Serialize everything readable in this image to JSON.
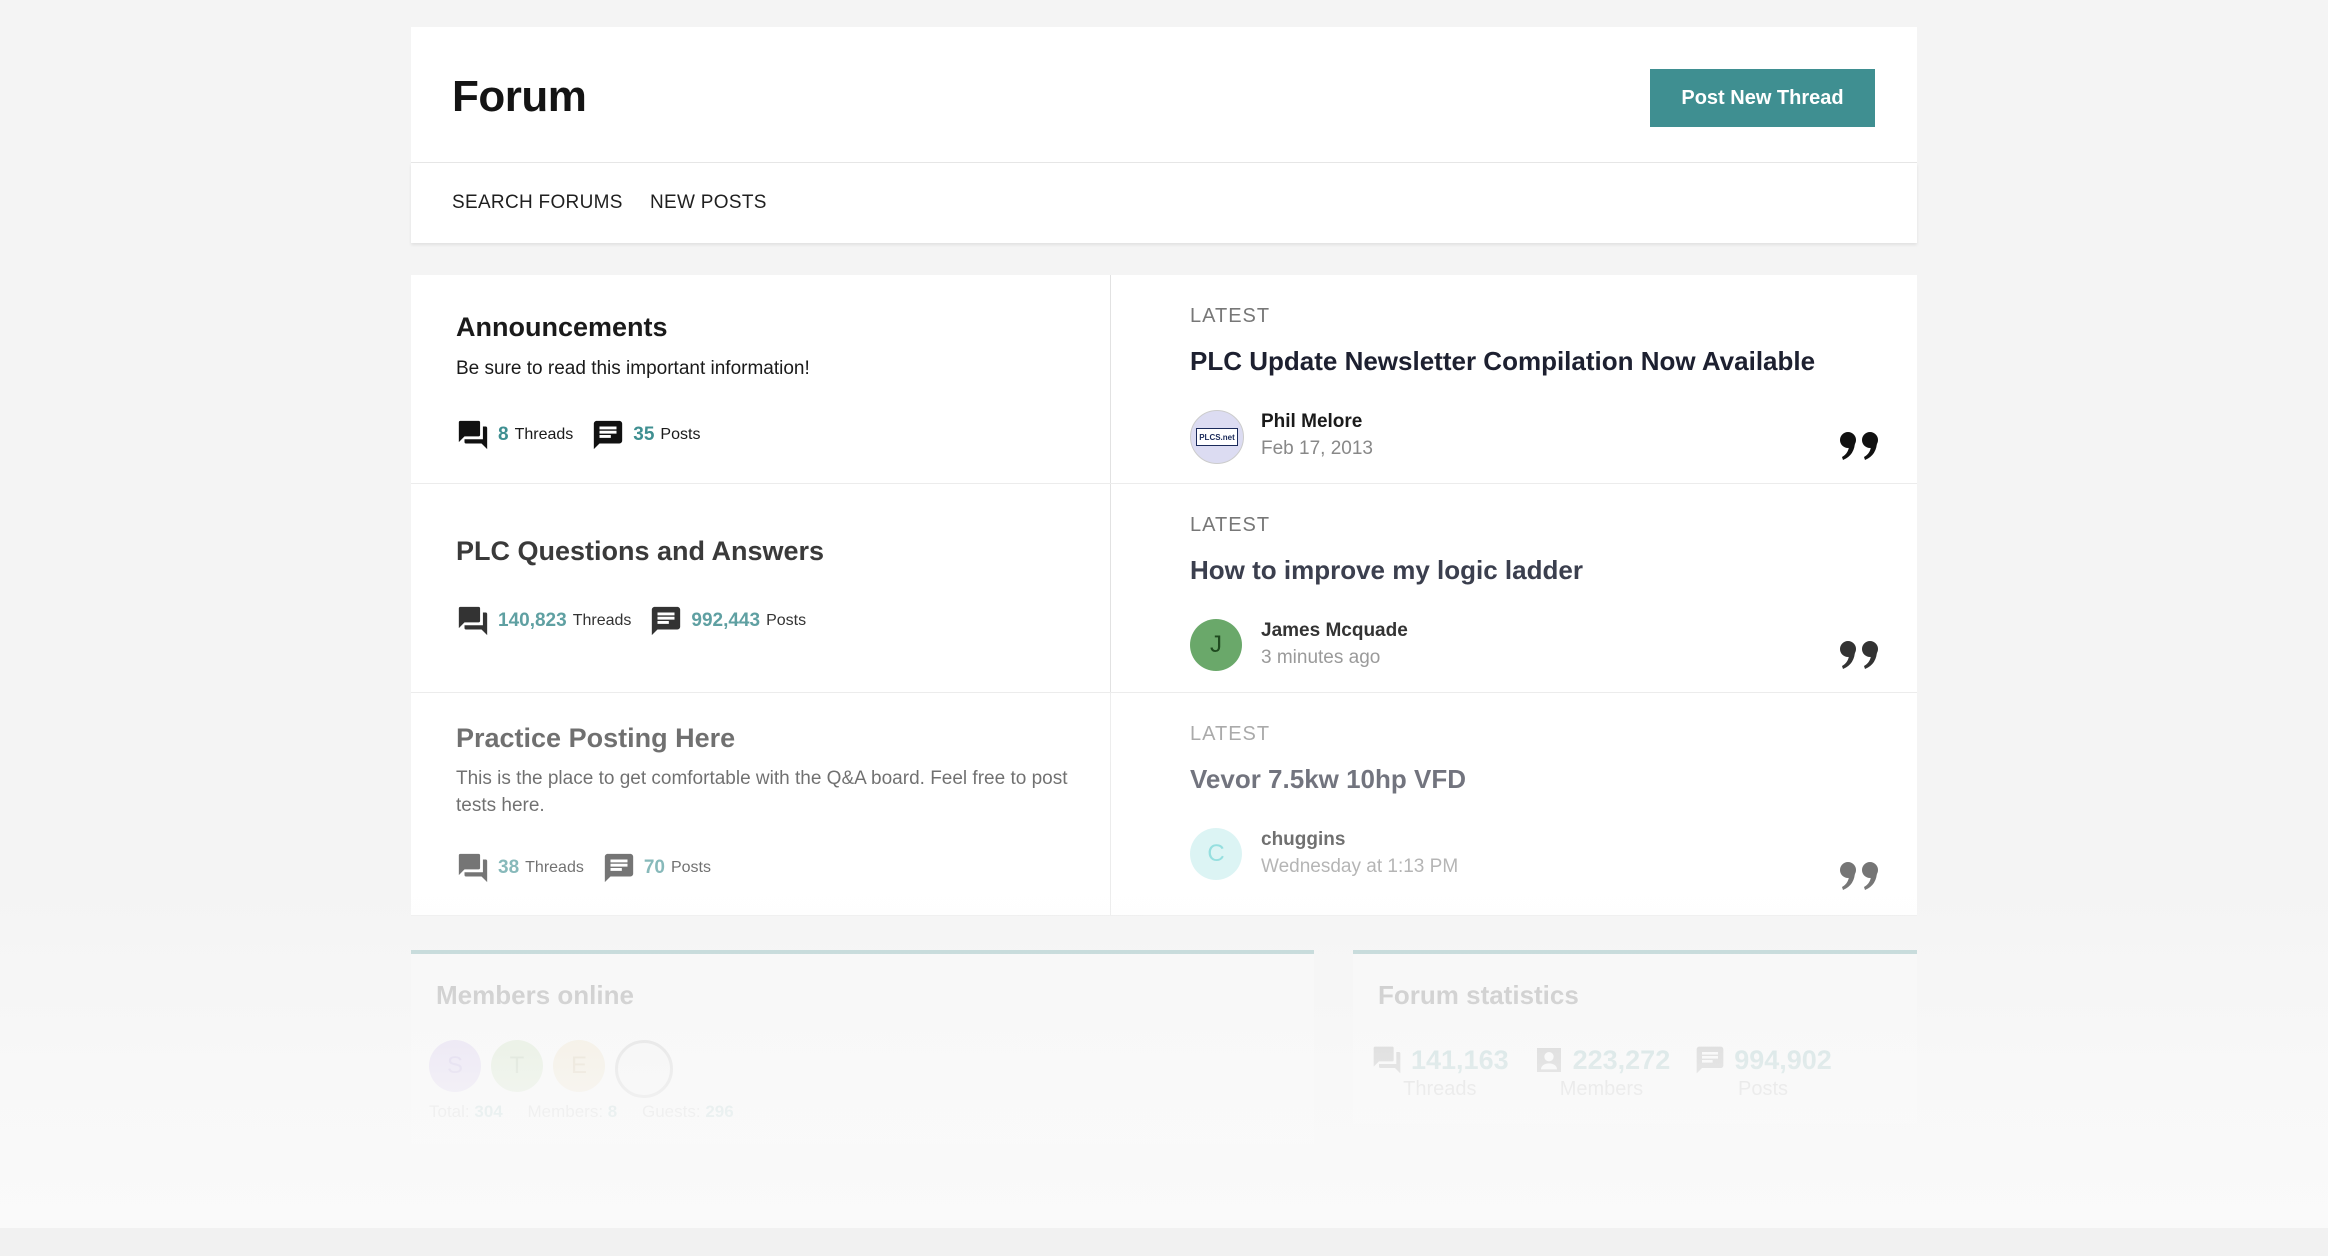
{
  "header": {
    "title": "Forum",
    "post_button": "Post New Thread"
  },
  "nav": {
    "items": [
      "SEARCH FORUMS",
      "NEW POSTS"
    ]
  },
  "forums": [
    {
      "title": "Announcements",
      "description": "Be sure to read this important information!",
      "threads": "8",
      "threads_label": "Threads",
      "posts": "35",
      "posts_label": "Posts",
      "latest_label": "LATEST",
      "latest_title": "PLC Update Newsletter Compilation Now Available",
      "latest_user": "Phil Melore",
      "latest_date": "Feb 17, 2013",
      "avatar_text": "PLCS.net"
    },
    {
      "title": "PLC Questions and Answers",
      "description": "",
      "threads": "140,823",
      "threads_label": "Threads",
      "posts": "992,443",
      "posts_label": "Posts",
      "latest_label": "LATEST",
      "latest_title": "How to improve my logic ladder",
      "latest_user": "James Mcquade",
      "latest_date": "3 minutes ago",
      "avatar_text": "J"
    },
    {
      "title": "Practice Posting Here",
      "description": "This is the place to get comfortable with the Q&A board. Feel free to post tests here.",
      "threads": "38",
      "threads_label": "Threads",
      "posts": "70",
      "posts_label": "Posts",
      "latest_label": "LATEST",
      "latest_title": "Vevor 7.5kw 10hp VFD",
      "latest_user": "chuggins",
      "latest_date": "Wednesday at 1:13 PM",
      "avatar_text": "C"
    }
  ],
  "members_online": {
    "title": "Members online",
    "avatars": [
      "S",
      "T",
      "E"
    ],
    "total_label": "Total:",
    "total": "304",
    "members_label": "Members:",
    "members": "8",
    "guests_label": "Guests:",
    "guests": "296"
  },
  "forum_statistics": {
    "title": "Forum statistics",
    "threads": "141,163",
    "threads_label": "Threads",
    "members": "223,272",
    "members_label": "Members",
    "posts": "994,902",
    "posts_label": "Posts"
  },
  "colors": {
    "accent": "#3f8f91",
    "avatar_j": "#6aa86a",
    "avatar_c": "#c8eeee"
  }
}
